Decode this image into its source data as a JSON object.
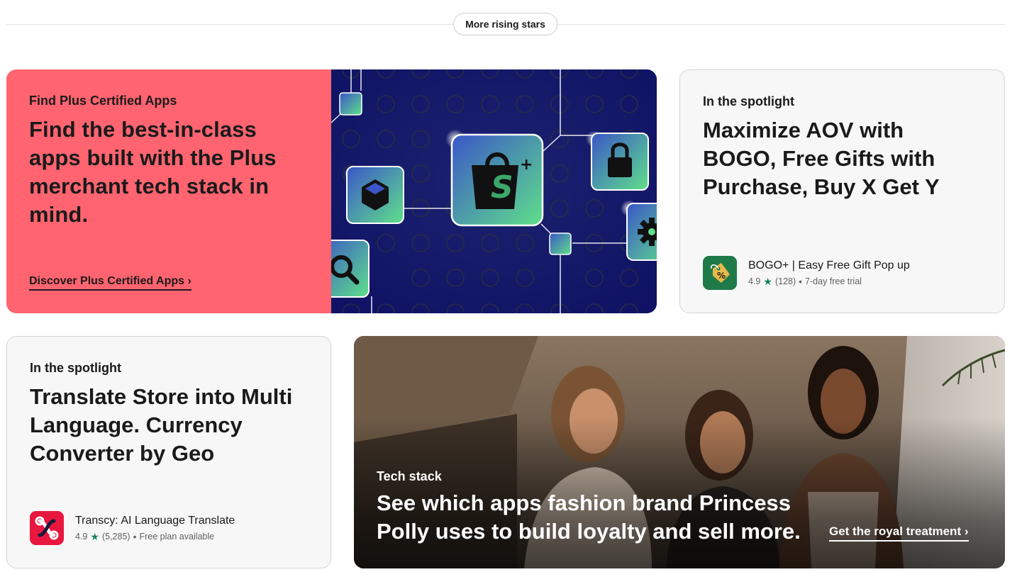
{
  "divider_pill": {
    "label": "More rising stars"
  },
  "plus_card": {
    "eyebrow": "Find Plus Certified Apps",
    "heading": "Find the best-in-class apps built with the Plus merchant tech stack in mind.",
    "link": "Discover Plus Certified Apps ›",
    "background_color": "#ff6470",
    "illustration_bg": "#14177a"
  },
  "spotlight_1": {
    "eyebrow": "In the spotlight",
    "heading": "Maximize AOV with BOGO, Free Gifts with Purchase, Buy X Get Y",
    "app": {
      "name": "BOGO+ | Easy Free Gift Pop up",
      "rating": "4.9",
      "reviews": "(128)",
      "pricing": "7-day free trial",
      "icon": "gift-tag-percent-icon",
      "icon_color": "#1f7a4a"
    }
  },
  "spotlight_2": {
    "eyebrow": "In the spotlight",
    "heading": "Translate Store into Multi Language. Currency Converter by Geo",
    "app": {
      "name": "Transcy: AI Language Translate",
      "rating": "4.9",
      "reviews": "(5,285)",
      "pricing": "Free plan available",
      "icon": "transcy-logo-icon",
      "icon_color": "#e8173f"
    }
  },
  "tech_stack_card": {
    "eyebrow": "Tech stack",
    "heading": "See which apps fashion brand Princess Polly uses to build loyalty and sell more.",
    "link": "Get the royal treatment ›"
  },
  "symbols": {
    "star": "★",
    "separator": "•"
  }
}
